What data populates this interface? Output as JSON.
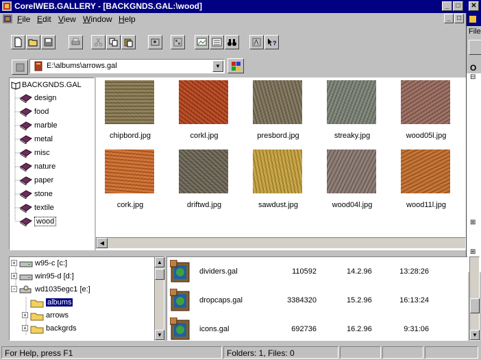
{
  "window": {
    "title": "CorelWEB.GALLERY - [BACKGNDS.GAL:\\wood]",
    "minimize": "_",
    "maximize": "□",
    "close": "✕"
  },
  "menu": [
    {
      "first": "F",
      "rest": "ile"
    },
    {
      "first": "E",
      "rest": "dit"
    },
    {
      "first": "V",
      "rest": "iew"
    },
    {
      "first": "W",
      "rest": "indow"
    },
    {
      "first": "H",
      "rest": "elp"
    }
  ],
  "path": {
    "value": "E:\\albums\\arrows.gal",
    "dropdown_icon": "▼"
  },
  "tree": {
    "root": "BACKGNDS.GAL",
    "items": [
      "design",
      "food",
      "marble",
      "metal",
      "misc",
      "nature",
      "paper",
      "stone",
      "textile",
      "wood"
    ],
    "selected": "wood"
  },
  "thumbnails": [
    {
      "name": "chipbord.jpg",
      "color": "#8a7a50"
    },
    {
      "name": "corkl.jpg",
      "color": "#b8431a"
    },
    {
      "name": "presbord.jpg",
      "color": "#7e7258"
    },
    {
      "name": "streaky.jpg",
      "color": "#7d8276"
    },
    {
      "name": "wood05l.jpg",
      "color": "#9a6a5c"
    },
    {
      "name": "cork.jpg",
      "color": "#d26c2a"
    },
    {
      "name": "driftwd.jpg",
      "color": "#6e6656"
    },
    {
      "name": "sawdust.jpg",
      "color": "#c9a43c"
    },
    {
      "name": "wood04l.jpg",
      "color": "#8a7870"
    },
    {
      "name": "wood11l.jpg",
      "color": "#c66e2a"
    }
  ],
  "drives": [
    {
      "label": "w95-c [c:]",
      "type": "drive"
    },
    {
      "label": "win95-d [d:]",
      "type": "drive"
    },
    {
      "label": "wd1035egc1 [e:]",
      "type": "cd"
    },
    {
      "label": "albums",
      "type": "folder-open",
      "selected": true
    },
    {
      "label": "arrows",
      "type": "folder"
    },
    {
      "label": "backgrds",
      "type": "folder"
    }
  ],
  "files": [
    {
      "name": "dividers.gal",
      "size": "110592",
      "date": "14.2.96",
      "time": "13:28:26"
    },
    {
      "name": "dropcaps.gal",
      "size": "3384320",
      "date": "15.2.96",
      "time": "16:13:24"
    },
    {
      "name": "icons.gal",
      "size": "692736",
      "date": "16.2.96",
      "time": "9:31:06"
    }
  ],
  "status": {
    "help": "For Help, press F1",
    "counts": "Folders: 1, Files: 0"
  },
  "right_window": {
    "menu_fragment": "File",
    "header_fragment": "O"
  },
  "colors": {
    "titlebar": "#000080",
    "face": "#c0c0c0",
    "selection": "#000080",
    "book": "#6b2d5c"
  }
}
